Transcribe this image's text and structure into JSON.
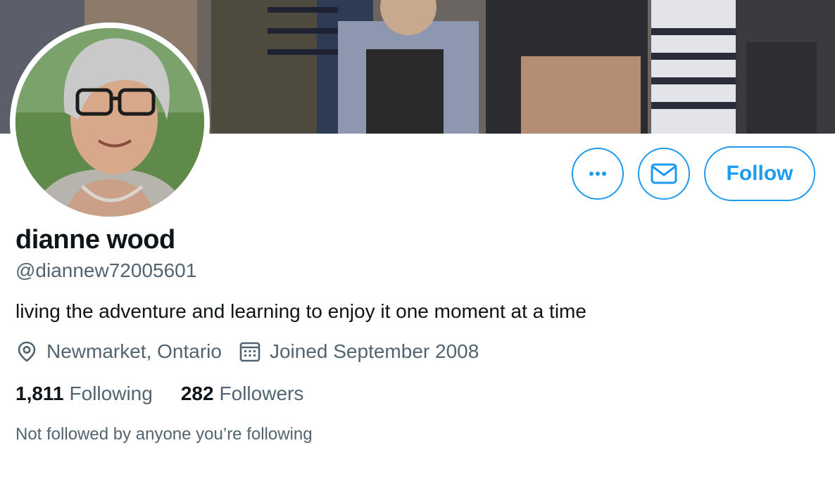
{
  "profile": {
    "name": "dianne wood",
    "handle": "@diannew72005601",
    "bio": "living the adventure and learning to enjoy it one moment at a time",
    "location": "Newmarket, Ontario",
    "joined": "Joined September 2008"
  },
  "stats": {
    "following_count": "1,811",
    "following_label": "Following",
    "followers_count": "282",
    "followers_label": "Followers"
  },
  "actions": {
    "more_icon": "more-icon",
    "message_icon": "mail-icon",
    "follow_label": "Follow"
  },
  "note": "Not followed by anyone you’re following",
  "colors": {
    "accent": "#1d9bf0",
    "text_primary": "#0f1419",
    "text_secondary": "#536471"
  }
}
